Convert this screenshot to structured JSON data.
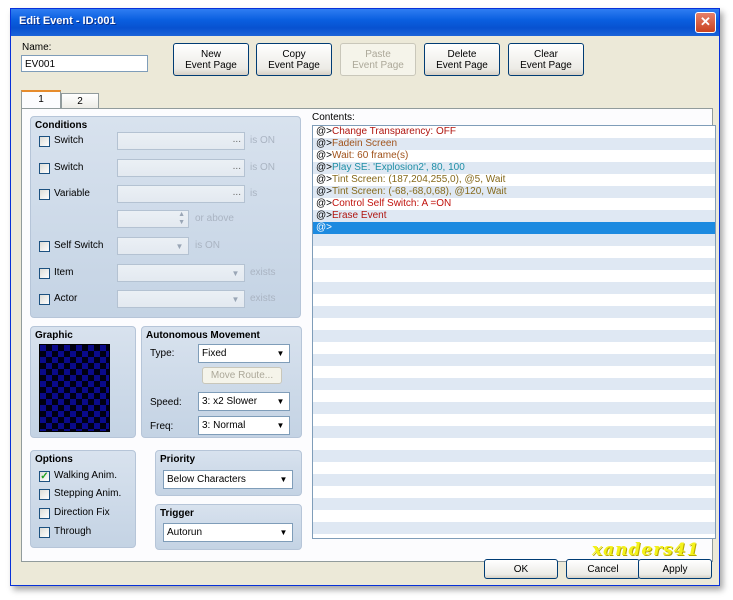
{
  "window": {
    "title": "Edit Event - ID:001",
    "close_label": "✕"
  },
  "name_field": {
    "label": "Name:",
    "value": "EV001"
  },
  "toolbar": {
    "new": "New\nEvent Page",
    "copy": "Copy\nEvent Page",
    "paste": "Paste\nEvent Page",
    "delete": "Delete\nEvent Page",
    "clear": "Clear\nEvent Page"
  },
  "tabs": [
    "1",
    "2"
  ],
  "conditions": {
    "title": "Conditions",
    "switch1": {
      "label": "Switch",
      "suffix": "is ON",
      "checked": false
    },
    "switch2": {
      "label": "Switch",
      "suffix": "is ON",
      "checked": false
    },
    "variable": {
      "label": "Variable",
      "suffix": "is",
      "or_above": "or above",
      "checked": false
    },
    "self_switch": {
      "label": "Self Switch",
      "suffix": "is ON",
      "checked": false
    },
    "item": {
      "label": "Item",
      "suffix": "exists",
      "checked": false
    },
    "actor": {
      "label": "Actor",
      "suffix": "exists",
      "checked": false
    },
    "ellipsis": "..."
  },
  "graphic": {
    "title": "Graphic"
  },
  "autonomous": {
    "title": "Autonomous Movement",
    "type_label": "Type:",
    "type_value": "Fixed",
    "move_route": "Move Route...",
    "speed_label": "Speed:",
    "speed_value": "3: x2 Slower",
    "freq_label": "Freq:",
    "freq_value": "3: Normal"
  },
  "options": {
    "title": "Options",
    "walking": {
      "label": "Walking Anim.",
      "checked": true
    },
    "stepping": {
      "label": "Stepping Anim.",
      "checked": false
    },
    "direction_fix": {
      "label": "Direction Fix",
      "checked": false
    },
    "through": {
      "label": "Through",
      "checked": false
    }
  },
  "priority": {
    "title": "Priority",
    "value": "Below Characters"
  },
  "trigger": {
    "title": "Trigger",
    "value": "Autorun"
  },
  "contents": {
    "label": "Contents:",
    "prefix": "@>",
    "lines": [
      {
        "text": "Change Transparency: OFF",
        "color": "#b0150f"
      },
      {
        "text": "Fadein Screen",
        "color": "#a0521a"
      },
      {
        "text": "Wait: 60 frame(s)",
        "color": "#a0521a"
      },
      {
        "text": "Play SE: 'Explosion2', 80, 100",
        "color": "#1f8fa6"
      },
      {
        "text": "Tint Screen: (187,204,255,0), @5, Wait",
        "color": "#866a1c"
      },
      {
        "text": "Tint Screen: (-68,-68,0,68), @120, Wait",
        "color": "#866a1c"
      },
      {
        "text": "Control Self Switch: A =ON",
        "color": "#c0120c"
      },
      {
        "text": "Erase Event",
        "color": "#b0150f"
      },
      {
        "text": "",
        "color": "#ffffff"
      }
    ],
    "selected_index": 8
  },
  "footer": {
    "ok": "OK",
    "cancel": "Cancel",
    "apply": "Apply"
  },
  "watermark": "xanders41",
  "colors": {
    "titlebar": "#0a5fe0",
    "selection": "#1c8ae0",
    "group_bg": "#c9d6e6"
  }
}
